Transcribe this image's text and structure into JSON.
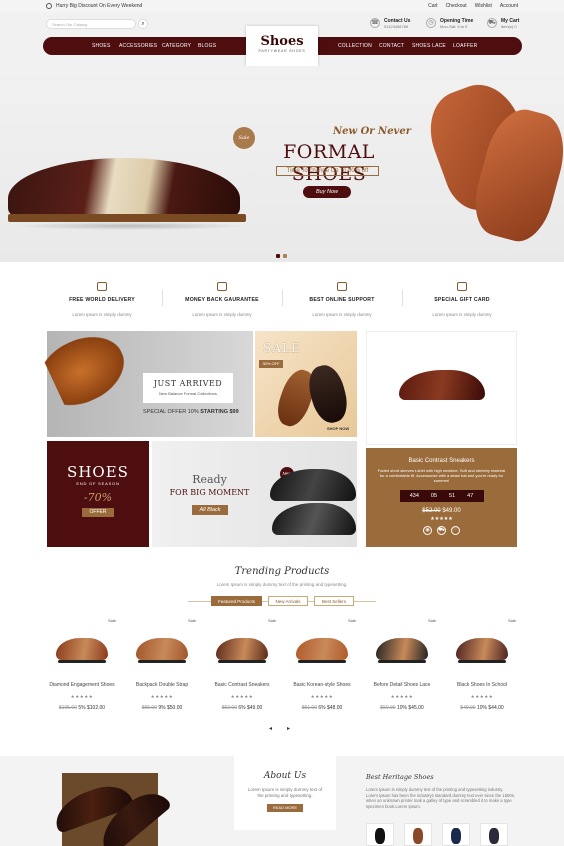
{
  "topbar": {
    "promo": "Hurry Big Discount On Every Weekend",
    "links": [
      "Cart",
      "Checkout",
      "Wishlist",
      "Account"
    ]
  },
  "header": {
    "search_placeholder": "Search Our Catalog",
    "contact": {
      "title": "Contact Us",
      "value": "01123456789"
    },
    "opening": {
      "title": "Opening Time",
      "value": "Mon-Sat: 9 to 5"
    },
    "cart": {
      "title": "My Cart",
      "value": "item(s) 0"
    }
  },
  "logo": {
    "name": "Shoes",
    "tagline": "PARTYWEAR SHOES"
  },
  "nav": {
    "left": [
      "SHOES",
      "ACCESSORIES",
      "CATEGORY",
      "BLOGS"
    ],
    "right": [
      "COLLECTION",
      "CONTACT",
      "SHOES LACE",
      "LOAFFER"
    ]
  },
  "hero": {
    "badge": "Sale",
    "kicker": "New Or Never",
    "title": "FORMAL SHOES",
    "sub": "Time To change Up To 50% off",
    "button": "Buy Now"
  },
  "features": [
    {
      "title": "FREE WORLD DELIVERY",
      "sub": "Lorem Ipsum is simply dummy"
    },
    {
      "title": "MONEY BACK GAURANTEE",
      "sub": "Lorem Ipsum is simply dummy"
    },
    {
      "title": "BEST ONLINE SUPPORT",
      "sub": "Lorem Ipsum is simply dummy"
    },
    {
      "title": "SPECIAL GIFT CARD",
      "sub": "Lorem Ipsum is simply dummy"
    }
  ],
  "banners": {
    "just": {
      "title": "JUST ARRIVED",
      "sub": "New Balance Formal Collections",
      "offer": "SPECIAL OFFER 10%",
      "offer_b": "STARTING $99"
    },
    "sale": {
      "title": "SALE",
      "badge": "30% OFF",
      "link": "SHOP NOW"
    },
    "shoes": {
      "title": "SHOES",
      "sub": "END OF SEASON",
      "pct": "-70%",
      "btn": "OFFER"
    },
    "ready": {
      "l1": "Ready",
      "l2": "FOR BIG MOMENT",
      "btn": "All Black",
      "badge": "New"
    },
    "deal": {
      "title": "Basic Contrast Sneakers",
      "desc": "Faded short sleeves t-shirt with high neckline. Soft and stretchy material for a comfortable fit. Accessorize with a straw hat and you're ready for summer!",
      "timer": [
        "434",
        "05",
        "51",
        "47"
      ],
      "old": "$52.00",
      "new": "$49.00"
    }
  },
  "trending": {
    "title": "Trending Products",
    "sub": "Lorem Ipsum is simply dummy text of the printing and typesetting.",
    "tabs": [
      "Featured Products",
      "New Arrivals",
      "Best Sellers"
    ]
  },
  "products": [
    {
      "name": "Diamond Engagement Shoes",
      "old": "$105.00",
      "off": "5%",
      "price": "$102.00",
      "color": "#8a3a1a",
      "stars": "★★★★★"
    },
    {
      "name": "Backpack Double Strap",
      "old": "$55.00",
      "off": "9%",
      "price": "$50.00",
      "color": "#a0552a",
      "stars": "★★★★★"
    },
    {
      "name": "Basic Contrast Sneakers",
      "old": "$52.00",
      "off": "6%",
      "price": "$49.00",
      "color": "#5a2a1a",
      "stars": "★★★★★"
    },
    {
      "name": "Basic Korean-style Shoes",
      "old": "$51.00",
      "off": "6%",
      "price": "$48.00",
      "color": "#b0592a",
      "stars": "★★★★★"
    },
    {
      "name": "Before Detail Shoes Lace",
      "old": "$50.00",
      "off": "10%",
      "price": "$45.00",
      "color": "#222222",
      "stars": "★★★★★"
    },
    {
      "name": "Black Shoes In School",
      "old": "$49.00",
      "off": "10%",
      "price": "$44.00",
      "color": "#4a2020",
      "stars": "★★★★★"
    }
  ],
  "product_sale": "Sale",
  "about": {
    "title": "About Us",
    "text": "Lorem Ipsum is simply dummy text of the printing and typesetting.",
    "btn": "READ MORE"
  },
  "heritage": {
    "title": "Best Heritage Shoes",
    "text": "Lorem Ipsum is simply dummy text of the printing and typesetting industry. Lorem Ipsum has been the industrys standard dummy text ever since the 1500s, when an unknown printer took a galley of type and scrambled it to make a type specimen book.Lorem Ipsum."
  },
  "colors": {
    "brand": "#4e0d0f",
    "accent": "#9a6b3b"
  }
}
